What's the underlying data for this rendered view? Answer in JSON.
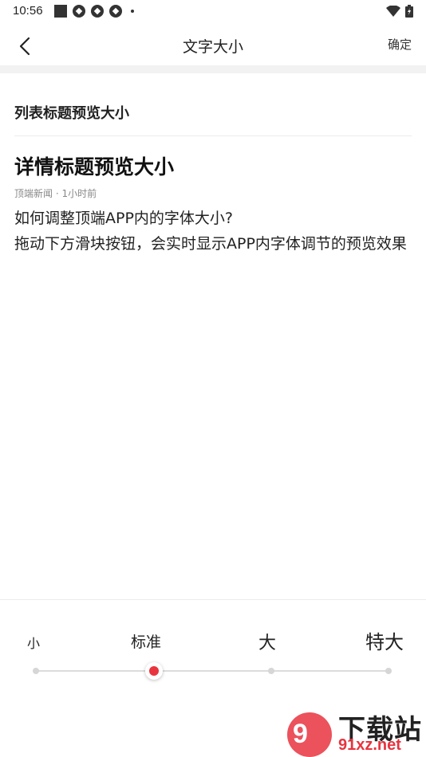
{
  "status_bar": {
    "time": "10:56",
    "left_icons": [
      "square-icon",
      "aperture-icon",
      "aperture-icon",
      "aperture-icon",
      "dot-icon"
    ],
    "right_icons": [
      "wifi-icon",
      "battery-charging-icon"
    ]
  },
  "header": {
    "title": "文字大小",
    "confirm_label": "确定",
    "back_icon": "chevron-left-icon"
  },
  "preview": {
    "list_title": "列表标题预览大小",
    "detail_title": "详情标题预览大小",
    "meta": "顶端新闻 · 1小时前",
    "paragraphs": [
      "如何调整顶端APP内的字体大小?",
      "拖动下方滑块按钮，会实时显示APP内字体调节的预览效果"
    ]
  },
  "font_size_slider": {
    "options": [
      "小",
      "标准",
      "大",
      "特大"
    ],
    "selected_index": 1,
    "selected_value": "标准",
    "accent_color": "#e8343f"
  },
  "watermark": {
    "logo_text": "9",
    "brand": "下载站",
    "url": "91xz.net"
  }
}
